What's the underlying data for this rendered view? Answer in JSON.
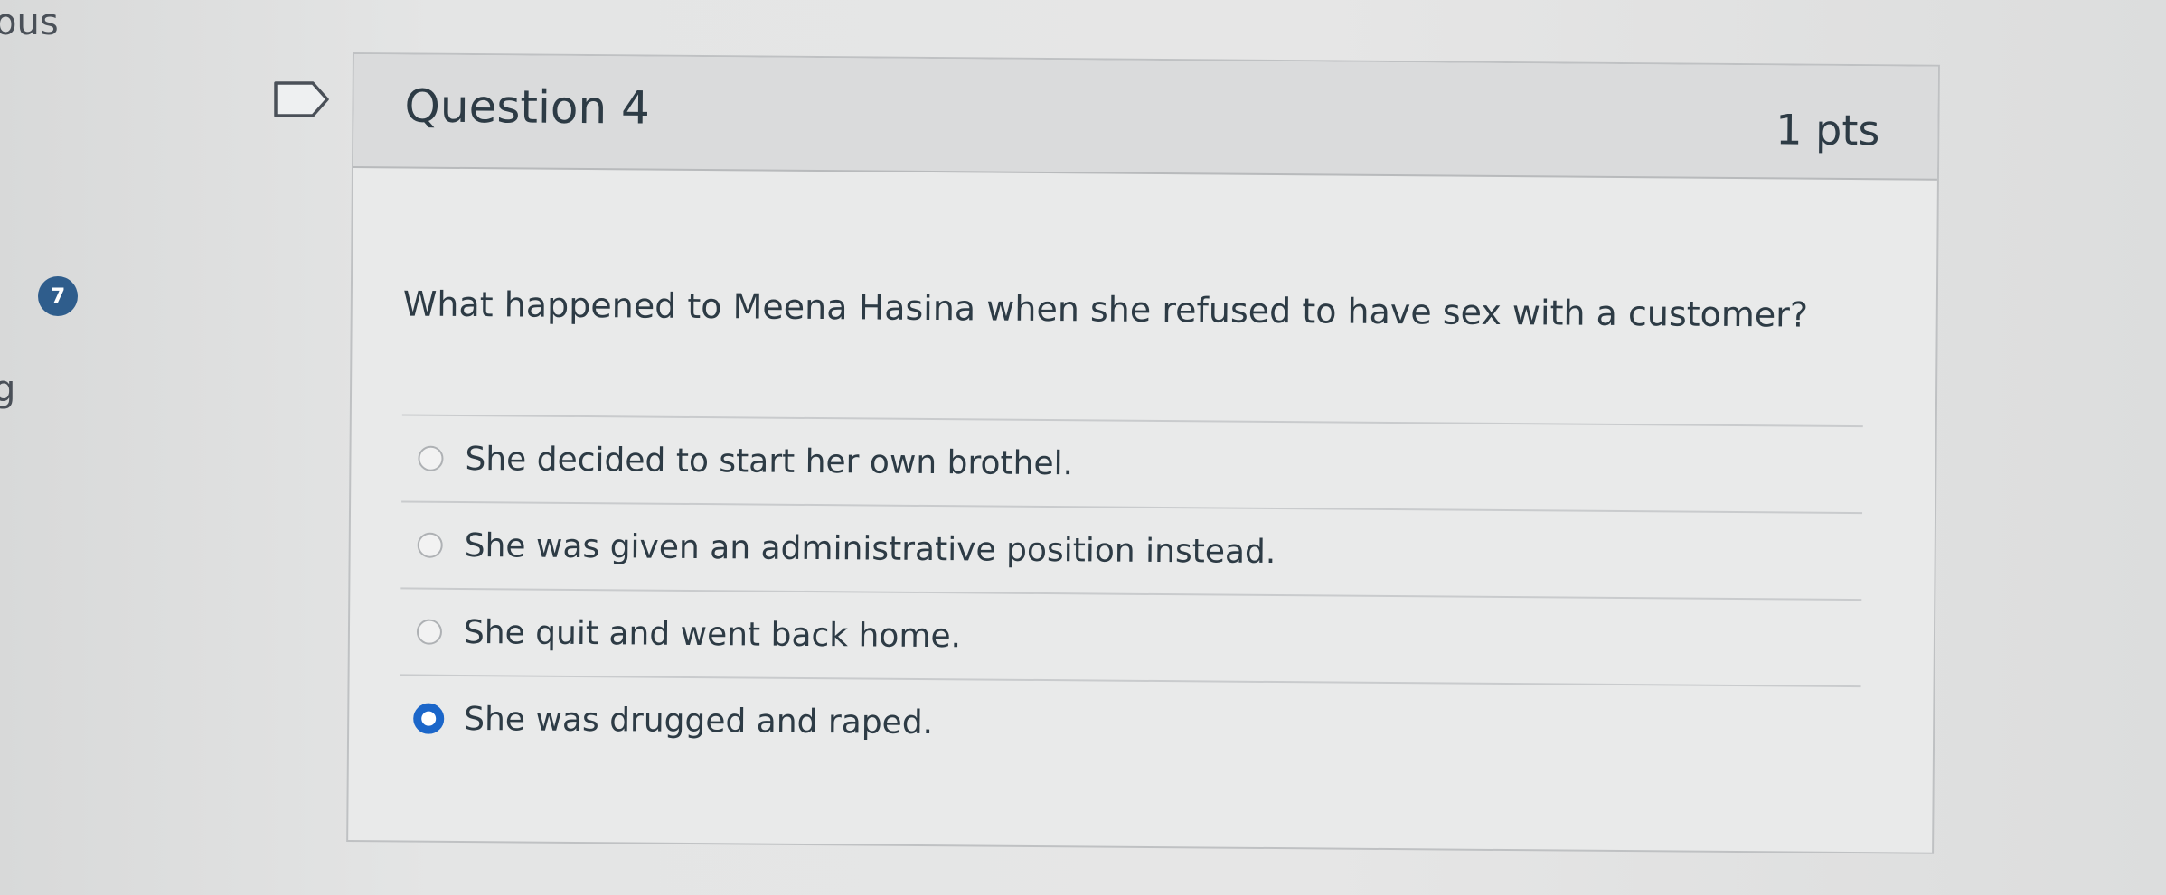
{
  "sidebar": {
    "partial_text_top": "ous",
    "question_number_badge": "7",
    "partial_text_mid": "g"
  },
  "question": {
    "title": "Question 4",
    "points": "1 pts",
    "text": "What happened to Meena Hasina when she refused to have sex with a customer?",
    "answers": [
      {
        "label": "She decided to start her own brothel.",
        "selected": false
      },
      {
        "label": "She was given an administrative position instead.",
        "selected": false
      },
      {
        "label": "She quit and went back home.",
        "selected": false
      },
      {
        "label": "She was drugged and raped.",
        "selected": true
      }
    ]
  },
  "colors": {
    "accent": "#1b66c9",
    "badge": "#2f5d8c",
    "text": "#2d3b45"
  },
  "icons": {
    "flag": "flag-question-icon"
  }
}
